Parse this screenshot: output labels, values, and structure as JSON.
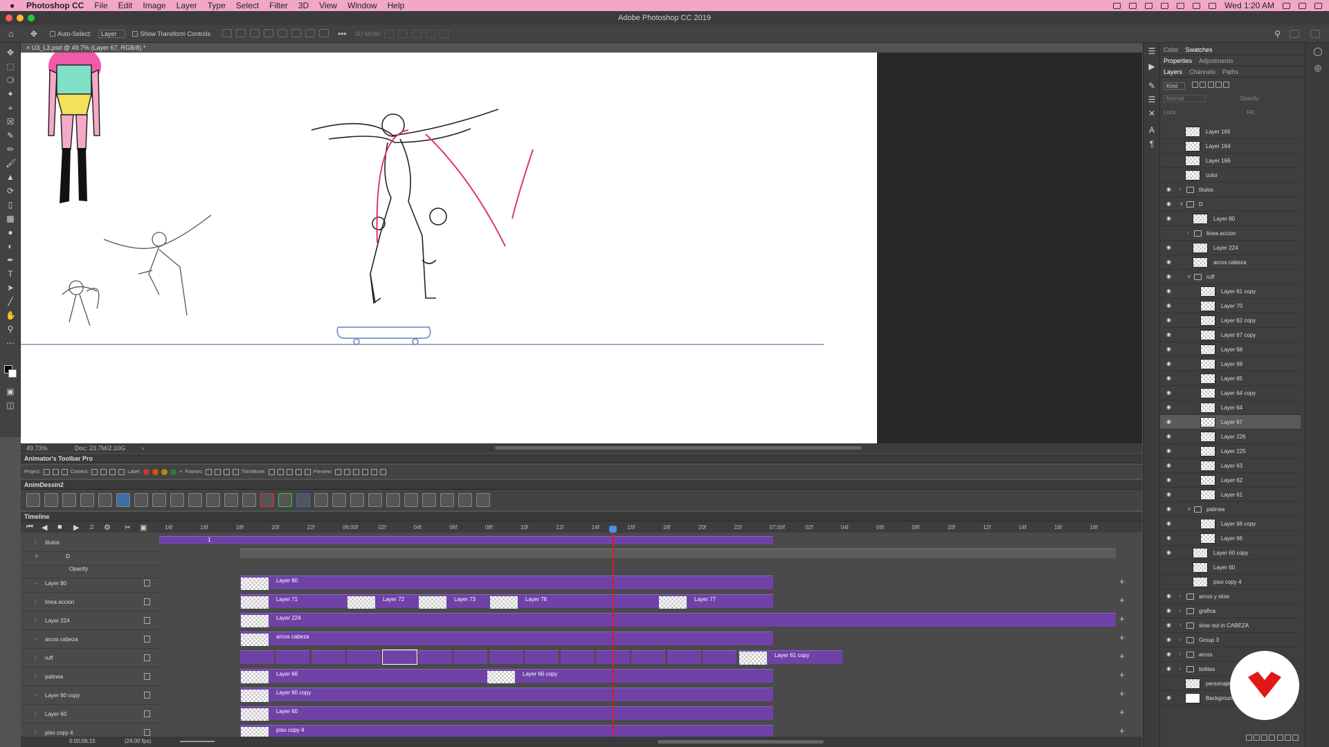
{
  "menubar": {
    "app": "Photoshop CC",
    "items": [
      "File",
      "Edit",
      "Image",
      "Layer",
      "Type",
      "Select",
      "Filter",
      "3D",
      "View",
      "Window",
      "Help"
    ],
    "clock": "Wed 1:20 AM"
  },
  "window": {
    "title": "Adobe Photoshop CC 2019"
  },
  "options": {
    "auto_select_label": "Auto-Select:",
    "auto_select_value": "Layer",
    "transform_label": "Show Transform Controls",
    "mode3d": "3D Mode:"
  },
  "document": {
    "tab": "U3_L3.psd @ 49.7% (Layer 67, RGB/8) *",
    "zoom": "49.73%",
    "doc_size": "Doc: 23.7M/2.10G"
  },
  "panels": {
    "tabs_top": [
      "Color",
      "Swatches"
    ],
    "tabs_mid": [
      "Properties",
      "Adjustments"
    ],
    "tabs_layers": [
      "Layers",
      "Channels",
      "Paths"
    ],
    "filter_kind": "Kind",
    "blend": "Normal",
    "opacity_label": "Opacity:",
    "lock_label": "Lock:",
    "fill_label": "Fill:"
  },
  "layers": [
    {
      "name": "Layer 165",
      "type": "layer",
      "indent": 0,
      "eye": false
    },
    {
      "name": "Layer 164",
      "type": "layer",
      "indent": 0,
      "eye": false
    },
    {
      "name": "Layer 166",
      "type": "layer",
      "indent": 0,
      "eye": false
    },
    {
      "name": "color",
      "type": "layer",
      "indent": 0,
      "eye": false
    },
    {
      "name": "titulos",
      "type": "group",
      "indent": 0,
      "eye": true
    },
    {
      "name": "D",
      "type": "group",
      "indent": 0,
      "eye": true,
      "open": true
    },
    {
      "name": "Layer 80",
      "type": "layer",
      "indent": 1,
      "eye": true
    },
    {
      "name": "linea accion",
      "type": "group",
      "indent": 1,
      "eye": false
    },
    {
      "name": "Layer 224",
      "type": "layer",
      "indent": 1,
      "eye": true
    },
    {
      "name": "arcos cabeza",
      "type": "layer",
      "indent": 1,
      "eye": true
    },
    {
      "name": "ruff",
      "type": "group",
      "indent": 1,
      "eye": true,
      "open": true
    },
    {
      "name": "Layer 61 copy",
      "type": "layer",
      "indent": 2,
      "eye": true
    },
    {
      "name": "Layer 70",
      "type": "layer",
      "indent": 2,
      "eye": true
    },
    {
      "name": "Layer 62 copy",
      "type": "layer",
      "indent": 2,
      "eye": true
    },
    {
      "name": "Layer 67 copy",
      "type": "layer",
      "indent": 2,
      "eye": true
    },
    {
      "name": "Layer 68",
      "type": "layer",
      "indent": 2,
      "eye": true
    },
    {
      "name": "Layer 69",
      "type": "layer",
      "indent": 2,
      "eye": true
    },
    {
      "name": "Layer 65",
      "type": "layer",
      "indent": 2,
      "eye": true
    },
    {
      "name": "Layer 64 copy",
      "type": "layer",
      "indent": 2,
      "eye": true
    },
    {
      "name": "Layer 64",
      "type": "layer",
      "indent": 2,
      "eye": true
    },
    {
      "name": "Layer 67",
      "type": "layer",
      "indent": 2,
      "eye": true,
      "selected": true
    },
    {
      "name": "Layer 226",
      "type": "layer",
      "indent": 2,
      "eye": true
    },
    {
      "name": "Layer 225",
      "type": "layer",
      "indent": 2,
      "eye": true
    },
    {
      "name": "Layer 63",
      "type": "layer",
      "indent": 2,
      "eye": true
    },
    {
      "name": "Layer 62",
      "type": "layer",
      "indent": 2,
      "eye": true
    },
    {
      "name": "Layer 61",
      "type": "layer",
      "indent": 2,
      "eye": true
    },
    {
      "name": "patinea",
      "type": "group",
      "indent": 1,
      "eye": true,
      "open": true
    },
    {
      "name": "Layer 66 copy",
      "type": "layer",
      "indent": 2,
      "eye": true
    },
    {
      "name": "Layer 66",
      "type": "layer",
      "indent": 2,
      "eye": true
    },
    {
      "name": "Layer 60 copy",
      "type": "layer",
      "indent": 1,
      "eye": true
    },
    {
      "name": "Layer 60",
      "type": "layer",
      "indent": 1,
      "eye": false
    },
    {
      "name": "piso copy 4",
      "type": "layer",
      "indent": 1,
      "eye": false
    },
    {
      "name": "arcos y slow",
      "type": "group",
      "indent": 0,
      "eye": true
    },
    {
      "name": "grafica",
      "type": "group",
      "indent": 0,
      "eye": true
    },
    {
      "name": "slow out in CABEZA",
      "type": "group",
      "indent": 0,
      "eye": true
    },
    {
      "name": "Group 3",
      "type": "group",
      "indent": 0,
      "eye": true
    },
    {
      "name": "arcos",
      "type": "group",
      "indent": 0,
      "eye": true
    },
    {
      "name": "bolitas",
      "type": "group",
      "indent": 0,
      "eye": true
    },
    {
      "name": "personajes",
      "type": "layer",
      "indent": 0,
      "eye": false
    },
    {
      "name": "Background",
      "type": "bg",
      "indent": 0,
      "eye": true
    }
  ],
  "animator_toolbar": {
    "title": "Animator's Toolbar Pro",
    "project": "Project:",
    "content": "Content:",
    "label": "Label:",
    "frames": "Frames:",
    "trimmove": "Trim/Move:",
    "preview": "Preview:"
  },
  "animdessin": {
    "title": "AnimDessin2"
  },
  "timeline": {
    "title": "Timeline",
    "ruler": [
      "14f",
      "16f",
      "18f",
      "20f",
      "22f",
      "06:00f",
      "02f",
      "04f",
      "06f",
      "08f",
      "10f",
      "12f",
      "14f",
      "16f",
      "18f",
      "20f",
      "22f",
      "07:00f",
      "02f",
      "04f",
      "06f",
      "08f",
      "10f",
      "12f",
      "14f",
      "16f",
      "18f"
    ],
    "timecode": "0:00:06:15",
    "fps": "(24.00 fps)",
    "tracks": [
      {
        "name": "titulos",
        "clips": [
          {
            "label": "1"
          }
        ]
      },
      {
        "name": "D"
      },
      {
        "name": "Opacity"
      },
      {
        "name": "Layer 80",
        "clips": [
          {
            "label": "Layer 80"
          }
        ]
      },
      {
        "name": "linea accion",
        "clips": [
          {
            "label": "Layer 71"
          },
          {
            "label": "Layer 72"
          },
          {
            "label": "Layer 73"
          },
          {
            "label": "Layer 76"
          },
          {
            "label": "Layer 77"
          }
        ]
      },
      {
        "name": "Layer 224",
        "clips": [
          {
            "label": "Layer 224"
          }
        ]
      },
      {
        "name": "arcos cabeza",
        "clips": [
          {
            "label": "arcos cabeza"
          }
        ]
      },
      {
        "name": "ruff",
        "clips": [
          {
            "label": "Layer 61 copy"
          }
        ]
      },
      {
        "name": "patinea",
        "clips": [
          {
            "label": "Layer 66"
          },
          {
            "label": "Layer 66 copy"
          }
        ]
      },
      {
        "name": "Layer 60 copy",
        "clips": [
          {
            "label": "Layer 60 copy"
          }
        ]
      },
      {
        "name": "Layer 60",
        "clips": [
          {
            "label": "Layer 60"
          }
        ]
      },
      {
        "name": "piso copy 4",
        "clips": [
          {
            "label": "piso copy 4"
          }
        ]
      }
    ]
  },
  "colors": {
    "accent": "#6f42a8",
    "playhead": "#d0202a",
    "menubar": "#f2a7c6"
  }
}
